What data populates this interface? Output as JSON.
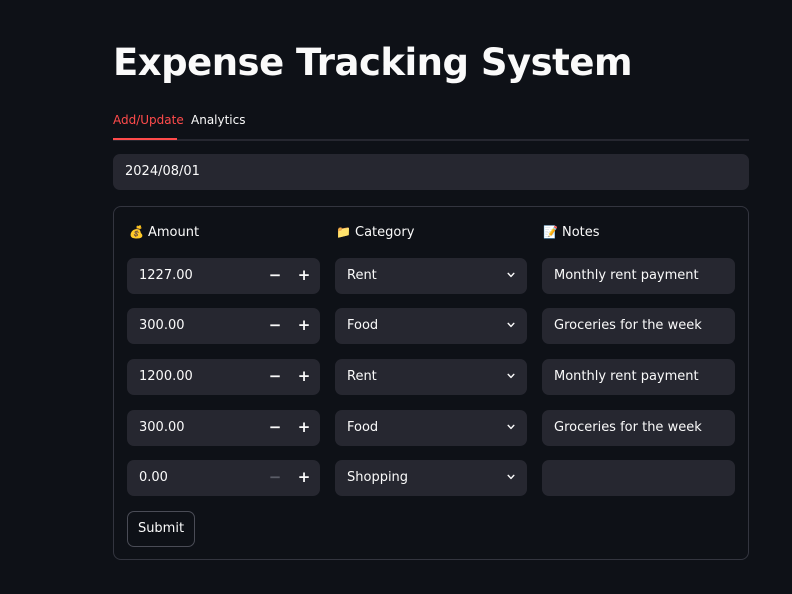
{
  "title": "Expense Tracking System",
  "tabs": [
    {
      "label": "Add/Update",
      "active": true
    },
    {
      "label": "Analytics",
      "active": false
    }
  ],
  "date_input": {
    "value": "2024/08/01"
  },
  "form": {
    "headers": {
      "amount": {
        "icon": "money-bag-icon",
        "glyph": "💰",
        "label": "Amount"
      },
      "category": {
        "icon": "folder-icon",
        "glyph": "📁",
        "label": "Category"
      },
      "notes": {
        "icon": "memo-icon",
        "glyph": "📝",
        "label": "Notes"
      }
    },
    "rows": [
      {
        "amount": "1227.00",
        "category": "Rent",
        "notes": "Monthly rent payment",
        "minus_disabled": false
      },
      {
        "amount": "300.00",
        "category": "Food",
        "notes": "Groceries for the week",
        "minus_disabled": false
      },
      {
        "amount": "1200.00",
        "category": "Rent",
        "notes": "Monthly rent payment",
        "minus_disabled": false
      },
      {
        "amount": "300.00",
        "category": "Food",
        "notes": "Groceries for the week",
        "minus_disabled": false
      },
      {
        "amount": "0.00",
        "category": "Shopping",
        "notes": "",
        "minus_disabled": true
      }
    ],
    "stepper": {
      "minus": "−",
      "plus": "+"
    },
    "submit_label": "Submit"
  },
  "colors": {
    "background": "#0e1117",
    "input_bg": "#262730",
    "accent": "#ff4b4b",
    "text": "#fafafa"
  }
}
